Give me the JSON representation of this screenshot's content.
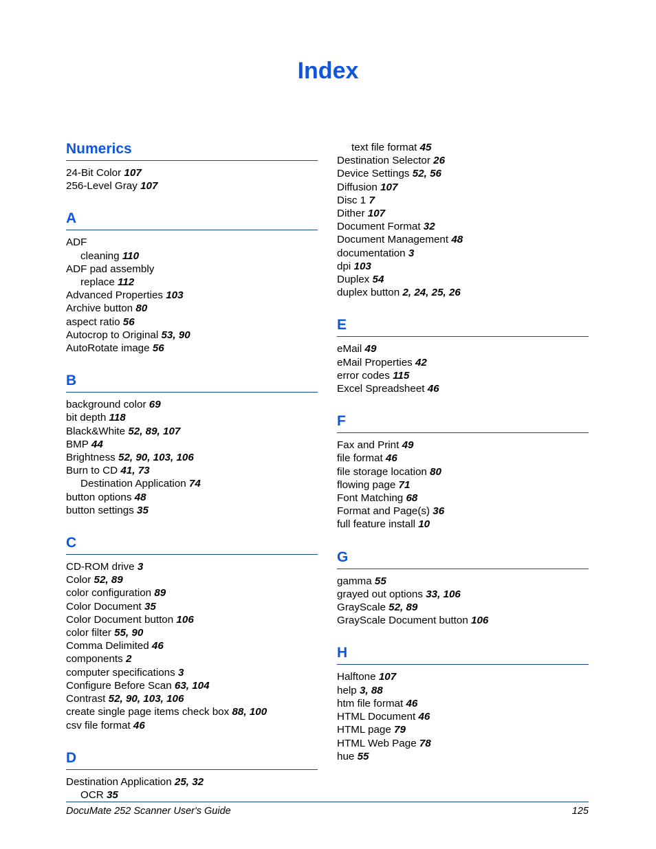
{
  "document": {
    "title": "Index",
    "accent_color": "#0F55DE",
    "rule_color": "#14469B"
  },
  "footer": {
    "guide_title": "DocuMate 252 Scanner User's Guide",
    "page_number": "125"
  },
  "columns": [
    {
      "id": "left",
      "sections": [
        {
          "heading": "Numerics",
          "entries": [
            {
              "term": "24-Bit Color",
              "pages": "107",
              "sub": false
            },
            {
              "term": "256-Level Gray",
              "pages": "107",
              "sub": false
            }
          ]
        },
        {
          "heading": "A",
          "entries": [
            {
              "term": "ADF",
              "pages": "",
              "sub": false
            },
            {
              "term": "cleaning",
              "pages": "110",
              "sub": true
            },
            {
              "term": "ADF pad assembly",
              "pages": "",
              "sub": false
            },
            {
              "term": "replace",
              "pages": "112",
              "sub": true
            },
            {
              "term": "Advanced Properties",
              "pages": "103",
              "sub": false
            },
            {
              "term": "Archive button",
              "pages": "80",
              "sub": false
            },
            {
              "term": "aspect ratio",
              "pages": "56",
              "sub": false
            },
            {
              "term": "Autocrop to Original",
              "pages": "53, 90",
              "sub": false
            },
            {
              "term": "AutoRotate image",
              "pages": "56",
              "sub": false
            }
          ]
        },
        {
          "heading": "B",
          "entries": [
            {
              "term": "background color",
              "pages": "69",
              "sub": false
            },
            {
              "term": "bit depth",
              "pages": "118",
              "sub": false
            },
            {
              "term": "Black&White",
              "pages": "52, 89, 107",
              "sub": false
            },
            {
              "term": "BMP",
              "pages": "44",
              "sub": false
            },
            {
              "term": "Brightness",
              "pages": "52, 90, 103, 106",
              "sub": false
            },
            {
              "term": "Burn to CD",
              "pages": "41, 73",
              "sub": false
            },
            {
              "term": "Destination Application",
              "pages": "74",
              "sub": true
            },
            {
              "term": "button options",
              "pages": "48",
              "sub": false
            },
            {
              "term": "button settings",
              "pages": "35",
              "sub": false
            }
          ]
        },
        {
          "heading": "C",
          "entries": [
            {
              "term": "CD-ROM drive",
              "pages": "3",
              "sub": false
            },
            {
              "term": "Color",
              "pages": "52, 89",
              "sub": false
            },
            {
              "term": "color configuration",
              "pages": "89",
              "sub": false
            },
            {
              "term": "Color Document",
              "pages": "35",
              "sub": false
            },
            {
              "term": "Color Document button",
              "pages": "106",
              "sub": false
            },
            {
              "term": "color filter",
              "pages": "55, 90",
              "sub": false
            },
            {
              "term": "Comma Delimited",
              "pages": "46",
              "sub": false
            },
            {
              "term": "components",
              "pages": "2",
              "sub": false
            },
            {
              "term": "computer specifications",
              "pages": "3",
              "sub": false
            },
            {
              "term": "Configure Before Scan",
              "pages": "63, 104",
              "sub": false
            },
            {
              "term": "Contrast",
              "pages": "52, 90, 103, 106",
              "sub": false
            },
            {
              "term": "create single page items check box",
              "pages": "88, 100",
              "sub": false
            },
            {
              "term": "csv file format",
              "pages": "46",
              "sub": false
            }
          ]
        },
        {
          "heading": "D",
          "entries": [
            {
              "term": "Destination Application",
              "pages": "25, 32",
              "sub": false
            },
            {
              "term": "OCR",
              "pages": "35",
              "sub": true
            }
          ]
        }
      ]
    },
    {
      "id": "right",
      "sections": [
        {
          "heading": "",
          "continuation": true,
          "entries": [
            {
              "term": "text file format",
              "pages": "45",
              "sub": true
            },
            {
              "term": "Destination Selector",
              "pages": "26",
              "sub": false
            },
            {
              "term": "Device Settings",
              "pages": "52, 56",
              "sub": false
            },
            {
              "term": "Diffusion",
              "pages": "107",
              "sub": false
            },
            {
              "term": "Disc 1",
              "pages": "7",
              "sub": false
            },
            {
              "term": "Dither",
              "pages": "107",
              "sub": false
            },
            {
              "term": "Document Format",
              "pages": "32",
              "sub": false
            },
            {
              "term": "Document Management",
              "pages": "48",
              "sub": false
            },
            {
              "term": "documentation",
              "pages": "3",
              "sub": false
            },
            {
              "term": "dpi",
              "pages": "103",
              "sub": false
            },
            {
              "term": "Duplex",
              "pages": "54",
              "sub": false
            },
            {
              "term": "duplex button",
              "pages": "2, 24, 25, 26",
              "sub": false
            }
          ]
        },
        {
          "heading": "E",
          "entries": [
            {
              "term": "eMail",
              "pages": "49",
              "sub": false
            },
            {
              "term": "eMail Properties",
              "pages": "42",
              "sub": false
            },
            {
              "term": "error codes",
              "pages": "115",
              "sub": false
            },
            {
              "term": "Excel Spreadsheet",
              "pages": "46",
              "sub": false
            }
          ]
        },
        {
          "heading": "F",
          "entries": [
            {
              "term": "Fax and Print",
              "pages": "49",
              "sub": false
            },
            {
              "term": "file format",
              "pages": "46",
              "sub": false
            },
            {
              "term": "file storage location",
              "pages": "80",
              "sub": false
            },
            {
              "term": "flowing page",
              "pages": "71",
              "sub": false
            },
            {
              "term": "Font Matching",
              "pages": "68",
              "sub": false
            },
            {
              "term": "Format and Page(s)",
              "pages": "36",
              "sub": false
            },
            {
              "term": "full feature install",
              "pages": "10",
              "sub": false
            }
          ]
        },
        {
          "heading": "G",
          "entries": [
            {
              "term": "gamma",
              "pages": "55",
              "sub": false
            },
            {
              "term": "grayed out options",
              "pages": "33, 106",
              "sub": false
            },
            {
              "term": "GrayScale",
              "pages": "52, 89",
              "sub": false
            },
            {
              "term": "GrayScale Document button",
              "pages": "106",
              "sub": false
            }
          ]
        },
        {
          "heading": "H",
          "entries": [
            {
              "term": "Halftone",
              "pages": "107",
              "sub": false
            },
            {
              "term": "help",
              "pages": "3, 88",
              "sub": false
            },
            {
              "term": "htm file format",
              "pages": "46",
              "sub": false
            },
            {
              "term": "HTML Document",
              "pages": "46",
              "sub": false
            },
            {
              "term": "HTML page",
              "pages": "79",
              "sub": false
            },
            {
              "term": "HTML Web Page",
              "pages": "78",
              "sub": false
            },
            {
              "term": "hue",
              "pages": "55",
              "sub": false
            }
          ]
        }
      ]
    }
  ]
}
